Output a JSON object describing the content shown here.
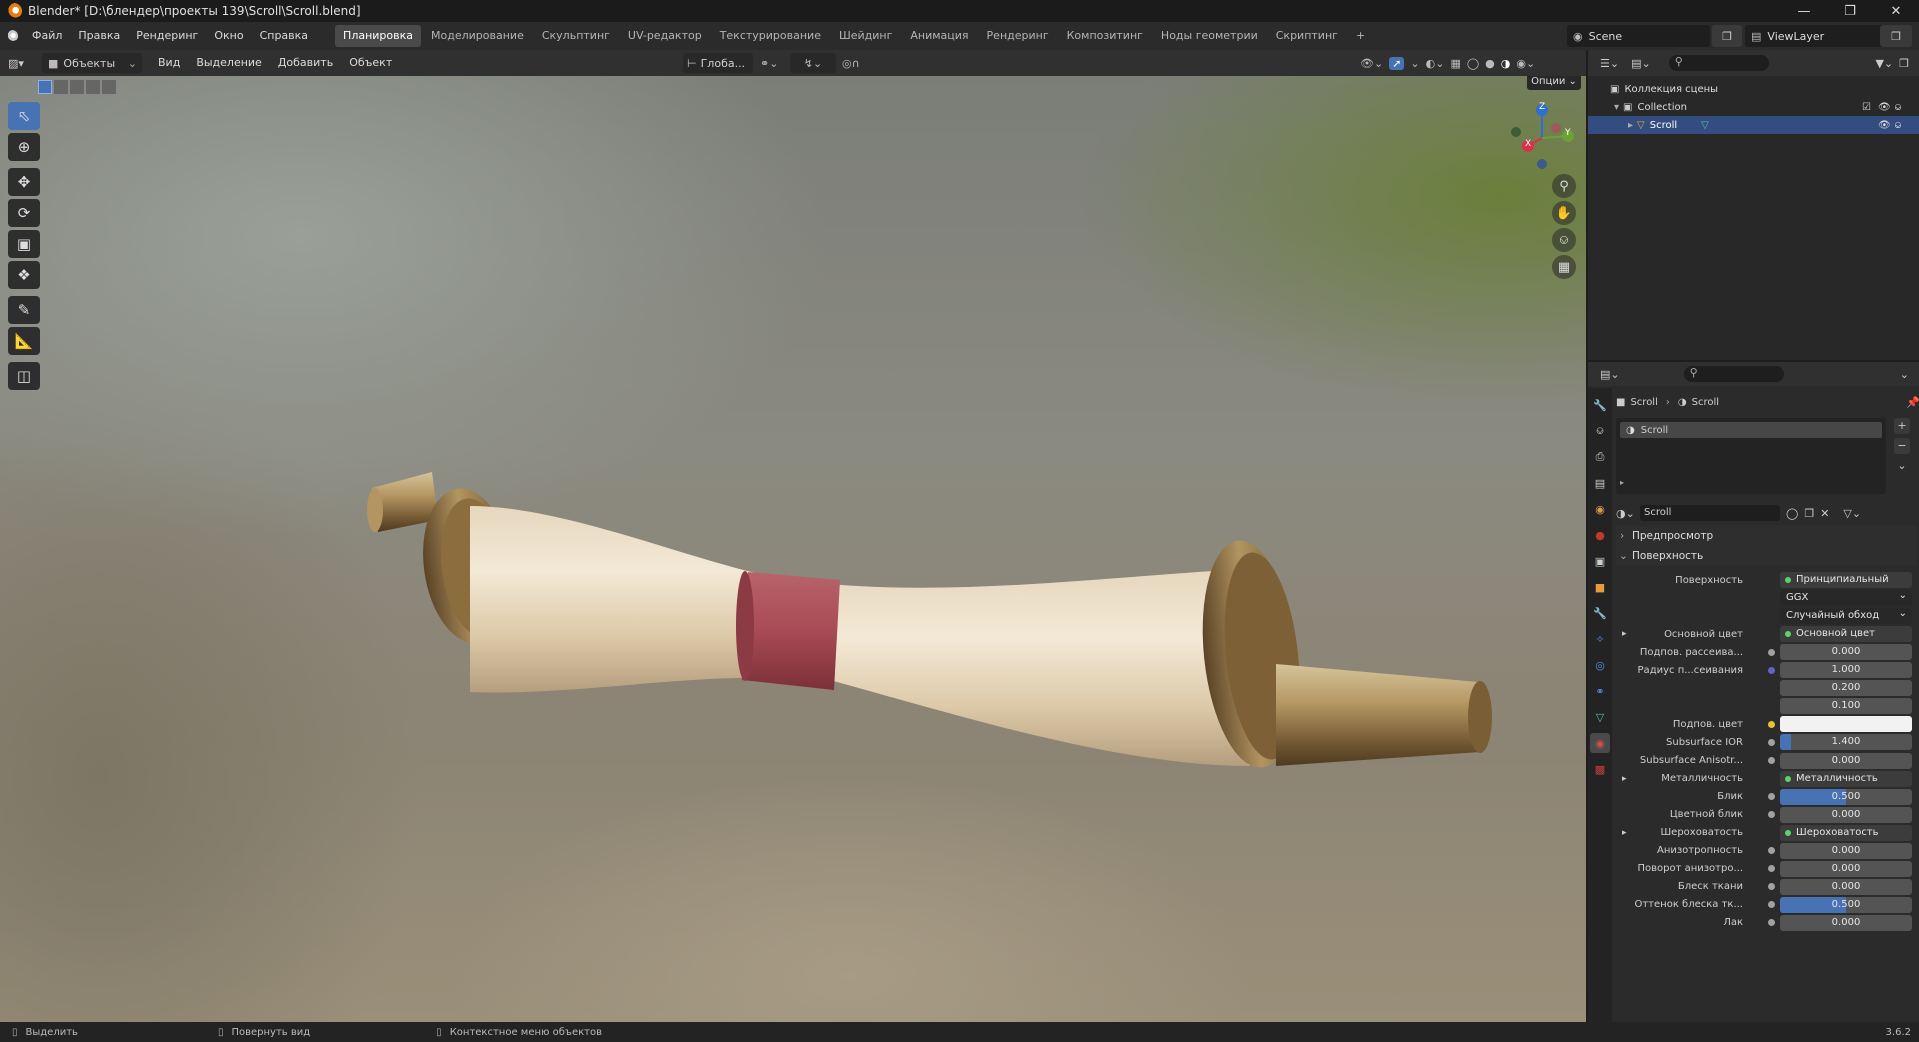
{
  "title": "Blender* [D:\\блендер\\проекты 139\\Scroll\\Scroll.blend]",
  "menu": [
    "Файл",
    "Правка",
    "Рендеринг",
    "Окно",
    "Справка"
  ],
  "workspaces": [
    "Планировка",
    "Моделирование",
    "Скульптинг",
    "UV-редактор",
    "Текстурирование",
    "Шейдинг",
    "Анимация",
    "Рендеринг",
    "Композитинг",
    "Ноды геометрии",
    "Скриптинг",
    "+"
  ],
  "scene_name": "Scene",
  "view_layer": "ViewLayer",
  "viewport_header": {
    "mode": "Объекты",
    "menus": [
      "Вид",
      "Выделение",
      "Добавить",
      "Объект"
    ],
    "orientation": "Глоба...",
    "options": "Опции"
  },
  "gizmo": {
    "x": "X",
    "y": "Y",
    "z": "Z"
  },
  "outliner": {
    "root": "Коллекция сцены",
    "collection": "Collection",
    "object": "Scroll"
  },
  "properties": {
    "breadcrumb_object": "Scroll",
    "breadcrumb_material": "Scroll",
    "slot_name": "Scroll",
    "material_name": "Scroll",
    "panel_preview": "Предпросмотр",
    "panel_surface": "Поверхность",
    "rows": [
      {
        "label": "Поверхность",
        "value": "Принципиальный BSDF",
        "type": "link",
        "dot": "#59d46d"
      },
      {
        "label": "",
        "value": "GGX",
        "type": "dropdown"
      },
      {
        "label": "",
        "value": "Случайный обход",
        "type": "dropdown"
      },
      {
        "label": "Основной цвет",
        "value": "Основной цвет",
        "type": "link",
        "dot": "#e6c42a",
        "expand": true
      },
      {
        "label": "Подпов. рассеива...",
        "value": "0.000",
        "type": "num",
        "dot": "#a1a1a1"
      },
      {
        "label": "Радиус п...сеивания",
        "value": "1.000",
        "type": "num",
        "dot": "#6363c7"
      },
      {
        "label": "",
        "value": "0.200",
        "type": "num"
      },
      {
        "label": "",
        "value": "0.100",
        "type": "num"
      },
      {
        "label": "Подпов. цвет",
        "value": "",
        "type": "color",
        "dot": "#e6c42a"
      },
      {
        "label": "Subsurface IOR",
        "value": "1.400",
        "type": "slider",
        "fill": 0.08,
        "dot": "#a1a1a1"
      },
      {
        "label": "Subsurface Anisotr...",
        "value": "0.000",
        "type": "num",
        "dot": "#a1a1a1"
      },
      {
        "label": "Металличность",
        "value": "Металличность",
        "type": "link",
        "dot": "#a1a1a1",
        "expand": true
      },
      {
        "label": "Блик",
        "value": "0.500",
        "type": "slider",
        "fill": 0.5,
        "dot": "#a1a1a1"
      },
      {
        "label": "Цветной блик",
        "value": "0.000",
        "type": "num",
        "dot": "#a1a1a1"
      },
      {
        "label": "Шероховатость",
        "value": "Шероховатость",
        "type": "link",
        "dot": "#a1a1a1",
        "expand": true
      },
      {
        "label": "Анизотропность",
        "value": "0.000",
        "type": "num",
        "dot": "#a1a1a1"
      },
      {
        "label": "Поворот анизотро...",
        "value": "0.000",
        "type": "num",
        "dot": "#a1a1a1"
      },
      {
        "label": "Блеск ткани",
        "value": "0.000",
        "type": "num",
        "dot": "#a1a1a1"
      },
      {
        "label": "Оттенок блеска тк...",
        "value": "0.500",
        "type": "slider",
        "fill": 0.5,
        "dot": "#a1a1a1"
      },
      {
        "label": "Лак",
        "value": "0.000",
        "type": "num",
        "dot": "#a1a1a1"
      }
    ]
  },
  "status": {
    "select": "Выделить",
    "rotate": "Повернуть вид",
    "context": "Контекстное меню объектов",
    "version": "3.6.2"
  },
  "colors": {
    "accent": "#4772b3",
    "selected_row": "#334d80",
    "link_green": "#59d46d"
  }
}
